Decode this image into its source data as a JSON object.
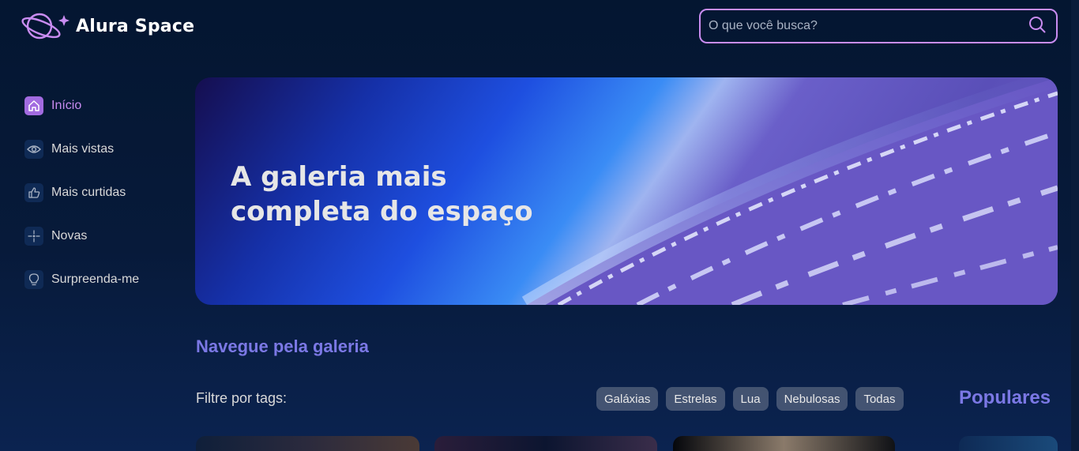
{
  "app": {
    "name": "Alura Space",
    "logo_icon": "planet-logo-icon"
  },
  "search": {
    "placeholder": "O que você busca?",
    "icon": "search-icon"
  },
  "sidebar": {
    "items": [
      {
        "label": "Início",
        "icon": "home-icon",
        "active": true
      },
      {
        "label": "Mais vistas",
        "icon": "eye-icon",
        "active": false
      },
      {
        "label": "Mais curtidas",
        "icon": "thumbs-up-icon",
        "active": false
      },
      {
        "label": "Novas",
        "icon": "sparkle-icon",
        "active": false
      },
      {
        "label": "Surpreenda-me",
        "icon": "lightbulb-icon",
        "active": false
      }
    ]
  },
  "banner": {
    "title": "A galeria mais completa do espaço"
  },
  "gallery": {
    "heading": "Navegue pela galeria",
    "filter_label": "Filtre por tags:",
    "tags": [
      "Galáxias",
      "Estrelas",
      "Lua",
      "Nebulosas",
      "Todas"
    ]
  },
  "popular": {
    "heading": "Populares"
  },
  "colors": {
    "background": "#041631",
    "accent_purple": "#c98cf1",
    "heading_purple": "#7b78e5",
    "tag_bg": "rgba(217,217,217,0.28)",
    "text": "#d9d9d9"
  }
}
